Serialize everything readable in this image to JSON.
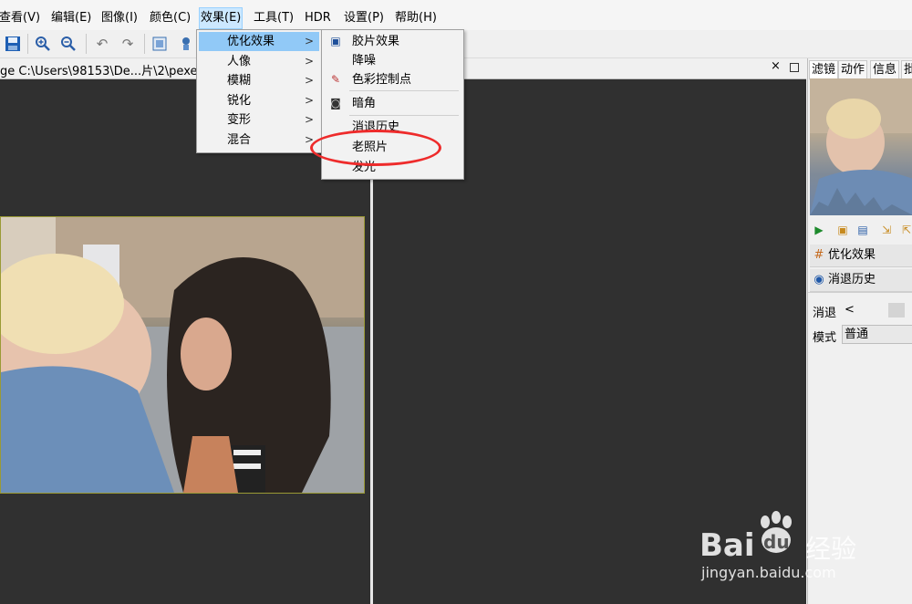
{
  "menubar": {
    "items": [
      "查看(V)",
      "编辑(E)",
      "图像(I)",
      "颜色(C)",
      "效果(E)",
      "工具(T)",
      "HDR",
      "设置(P)",
      "帮助(H)"
    ]
  },
  "document": {
    "tab_title": "ge C:\\Users\\98153\\De...片\\2\\pexe",
    "close_glyph": "×"
  },
  "effects_menu": {
    "items": [
      {
        "label": "优化效果",
        "has_submenu": true
      },
      {
        "label": "人像",
        "has_submenu": true
      },
      {
        "label": "模糊",
        "has_submenu": true
      },
      {
        "label": "锐化",
        "has_submenu": true
      },
      {
        "label": "变形",
        "has_submenu": true
      },
      {
        "label": "混合",
        "has_submenu": true
      }
    ],
    "submenu_arrow": ">"
  },
  "optimize_submenu": {
    "items": [
      {
        "label": "胶片效果",
        "icon": "film-icon"
      },
      {
        "label": "降噪",
        "icon": ""
      },
      {
        "label": "色彩控制点",
        "icon": "color-point-icon"
      },
      {
        "label": "暗角",
        "icon": "vignette-icon"
      },
      {
        "label": "消退历史",
        "icon": ""
      },
      {
        "label": "老照片",
        "icon": ""
      },
      {
        "label": "发光",
        "icon": ""
      }
    ]
  },
  "right_panel": {
    "tabs": [
      "滤镜",
      "动作",
      "信息",
      "批"
    ],
    "rows": [
      {
        "label": "优化效果",
        "icon": "grid-icon"
      },
      {
        "label": "消退历史",
        "icon": "radio-icon"
      }
    ],
    "fade_label": "消退",
    "fade_arrow": "<",
    "mode_label": "模式",
    "mode_value": "普通"
  },
  "watermark": {
    "brand": "Bai",
    "brand2": "du",
    "jingyan": "经验",
    "url": "jingyan.baidu.com"
  },
  "colors": {
    "menu_highlight": "#91c9f7",
    "annotation": "#ee2b2b",
    "canvas": "#303030"
  }
}
